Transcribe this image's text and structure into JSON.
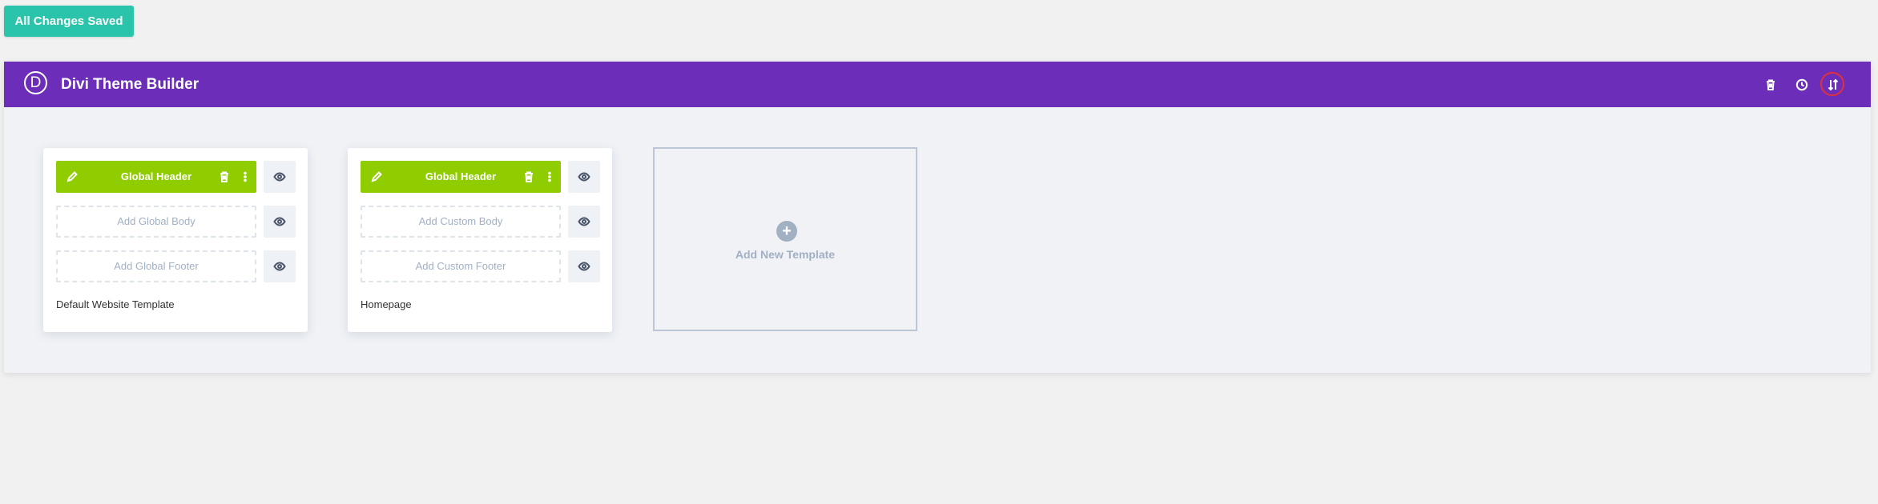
{
  "save_status": "All Changes Saved",
  "header": {
    "logo_letter": "D",
    "title": "Divi Theme Builder",
    "icons": [
      "trash-icon",
      "history-icon",
      "import-export-icon"
    ]
  },
  "templates": [
    {
      "header_label": "Global Header",
      "body_label": "Add Global Body",
      "footer_label": "Add Global Footer",
      "name": "Default Website Template"
    },
    {
      "header_label": "Global Header",
      "body_label": "Add Custom Body",
      "footer_label": "Add Custom Footer",
      "name": "Homepage"
    }
  ],
  "add_template": {
    "plus": "+",
    "label": "Add New Template"
  },
  "colors": {
    "brand_purple": "#6c2eb9",
    "save_green": "#29c4a9",
    "header_green": "#90cd00",
    "highlight_red": "#e0303c"
  }
}
